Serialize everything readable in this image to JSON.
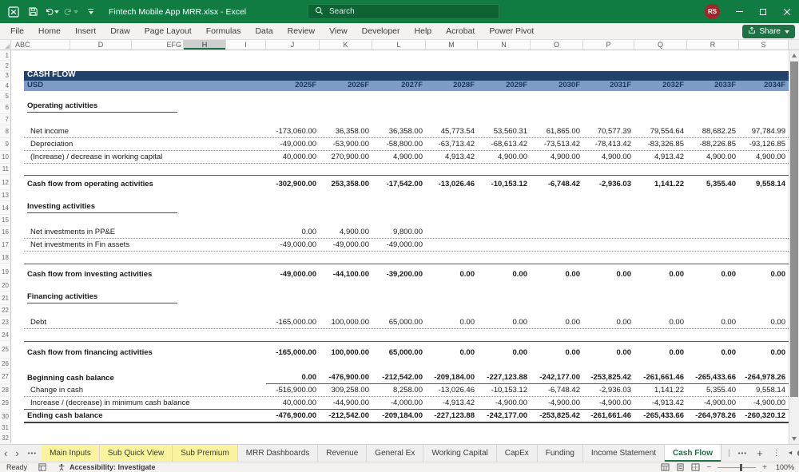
{
  "title_bar": {
    "title": "Fintech Mobile App MRR.xlsx - Excel",
    "search_placeholder": "Search",
    "avatar_initials": "RS"
  },
  "ribbon": {
    "tabs": [
      "File",
      "Home",
      "Insert",
      "Draw",
      "Page Layout",
      "Formulas",
      "Data",
      "Review",
      "View",
      "Developer",
      "Help",
      "Acrobat",
      "Power Pivot"
    ],
    "share_label": "Share"
  },
  "columns": {
    "headers": [
      "ABC",
      "D",
      "EFG",
      "H",
      "I",
      "J",
      "K",
      "L",
      "M",
      "N",
      "O",
      "P",
      "Q",
      "R",
      "S"
    ],
    "selected": "H"
  },
  "sheet": {
    "rows": [
      {
        "n": 1
      },
      {
        "n": 2
      },
      {
        "n": 3,
        "type": "banner-dark",
        "label": "CASH FLOW"
      },
      {
        "n": 4,
        "type": "banner-blue",
        "label": "USD",
        "values": [
          "2025F",
          "2026F",
          "2027F",
          "2028F",
          "2029F",
          "2030F",
          "2031F",
          "2032F",
          "2033F",
          "2034F"
        ]
      },
      {
        "n": 5
      },
      {
        "n": 6,
        "type": "heading",
        "label": "Operating activities"
      },
      {
        "n": 7
      },
      {
        "n": 8,
        "type": "item",
        "border": "dotted",
        "label": "Net income",
        "values": [
          "-173,060.00",
          "36,358.00",
          "36,358.00",
          "45,773.54",
          "53,560.31",
          "61,865.00",
          "70,577.39",
          "79,554.64",
          "88,682.25",
          "97,784.99"
        ]
      },
      {
        "n": 9,
        "type": "item",
        "border": "dotted",
        "label": "Depreciation",
        "values": [
          "-49,000.00",
          "-53,900.00",
          "-58,800.00",
          "-63,713.42",
          "-68,613.42",
          "-73,513.42",
          "-78,413.42",
          "-83,326.85",
          "-88,226.85",
          "-93,126.85"
        ]
      },
      {
        "n": 10,
        "type": "item",
        "border": "dotted",
        "label": "(Increase) / decrease in working capital",
        "values": [
          "40,000.00",
          "270,900.00",
          "4,900.00",
          "4,913.42",
          "4,900.00",
          "4,900.00",
          "4,900.00",
          "4,913.42",
          "4,900.00",
          "4,900.00"
        ]
      },
      {
        "n": 11
      },
      {
        "n": 12,
        "type": "total",
        "label": "Cash flow from operating activities",
        "values": [
          "-302,900.00",
          "253,358.00",
          "-17,542.00",
          "-13,026.46",
          "-10,153.12",
          "-6,748.42",
          "-2,936.03",
          "1,141.22",
          "5,355.40",
          "9,558.14"
        ]
      },
      {
        "n": 13
      },
      {
        "n": 14,
        "type": "heading",
        "label": "Investing activities"
      },
      {
        "n": 15
      },
      {
        "n": 16,
        "type": "item",
        "border": "dotted",
        "label": "Net investments in PP&E",
        "values": [
          "0.00",
          "4,900.00",
          "9,800.00",
          "",
          "",
          "",
          "",
          "",
          "",
          ""
        ]
      },
      {
        "n": 17,
        "type": "item",
        "border": "dotted",
        "label": "Net investments in Fin assets",
        "values": [
          "-49,000.00",
          "-49,000.00",
          "-49,000.00",
          "",
          "",
          "",
          "",
          "",
          "",
          ""
        ]
      },
      {
        "n": 18
      },
      {
        "n": 19,
        "type": "total",
        "label": "Cash flow from investing activities",
        "values": [
          "-49,000.00",
          "-44,100.00",
          "-39,200.00",
          "0.00",
          "0.00",
          "0.00",
          "0.00",
          "0.00",
          "0.00",
          "0.00"
        ]
      },
      {
        "n": 20
      },
      {
        "n": 21,
        "type": "heading",
        "label": "Financing activities"
      },
      {
        "n": 22
      },
      {
        "n": 23,
        "type": "item",
        "border": "dotted",
        "label": "Debt",
        "values": [
          "-165,000.00",
          "100,000.00",
          "65,000.00",
          "0.00",
          "0.00",
          "0.00",
          "0.00",
          "0.00",
          "0.00",
          "0.00"
        ]
      },
      {
        "n": 24
      },
      {
        "n": 25,
        "type": "total",
        "label": "Cash flow from financing activities",
        "values": [
          "-165,000.00",
          "100,000.00",
          "65,000.00",
          "0.00",
          "0.00",
          "0.00",
          "0.00",
          "0.00",
          "0.00",
          "0.00"
        ]
      },
      {
        "n": 26
      },
      {
        "n": 27,
        "type": "balance-start",
        "label": "Beginning cash balance",
        "values": [
          "0.00",
          "-476,900.00",
          "-212,542.00",
          "-209,184.00",
          "-227,123.88",
          "-242,177.00",
          "-253,825.42",
          "-261,661.46",
          "-265,433.66",
          "-264,978.26"
        ]
      },
      {
        "n": 28,
        "type": "item",
        "border": "dotted",
        "label": "Change in cash",
        "values": [
          "-516,900.00",
          "309,258.00",
          "8,258.00",
          "-13,026.46",
          "-10,153.12",
          "-6,748.42",
          "-2,936.03",
          "1,141.22",
          "5,355.40",
          "9,558.14"
        ]
      },
      {
        "n": 29,
        "type": "item",
        "border": "solid",
        "label": "Increase / (decrease) in minimum cash balance",
        "values": [
          "40,000.00",
          "-44,900.00",
          "-4,000.00",
          "-4,913.42",
          "-4,900.00",
          "-4,900.00",
          "-4,900.00",
          "-4,913.42",
          "-4,900.00",
          "-4,900.00"
        ]
      },
      {
        "n": 30,
        "type": "balance-end",
        "label": "Ending cash balance",
        "values": [
          "-476,900.00",
          "-212,542.00",
          "-209,184.00",
          "-227,123.88",
          "-242,177.00",
          "-253,825.42",
          "-261,661.46",
          "-265,433.66",
          "-264,978.26",
          "-260,320.12"
        ]
      },
      {
        "n": 31
      },
      {
        "n": 32
      }
    ]
  },
  "sheet_tabs": [
    {
      "label": "Main Inputs",
      "color": "yellow"
    },
    {
      "label": "Sub Quick View",
      "color": "yellow"
    },
    {
      "label": "Sub Premium",
      "color": "yellow"
    },
    {
      "label": "MRR Dashboards"
    },
    {
      "label": "Revenue"
    },
    {
      "label": "General Ex"
    },
    {
      "label": "Working Capital"
    },
    {
      "label": "CapEx"
    },
    {
      "label": "Funding"
    },
    {
      "label": "Income Statement"
    },
    {
      "label": "Cash Flow",
      "active": true
    }
  ],
  "status": {
    "ready": "Ready",
    "accessibility": "Accessibility: Investigate",
    "zoom": "100%"
  },
  "icons": {
    "prev_sheet": "‹",
    "next_sheet": "›",
    "more_dots": "•••",
    "pipe": "|",
    "add_sheet": "+",
    "kebab": "⋮",
    "scroll_left": "◄",
    "scroll_right": "►",
    "zoom_minus": "−",
    "zoom_plus": "+"
  },
  "colors": {
    "excel_green": "#107C41",
    "banner_dark": "#20426B",
    "banner_blue": "#7E9CC8",
    "tab_yellow": "#FBF3A0",
    "avatar_red": "#A4262C"
  }
}
